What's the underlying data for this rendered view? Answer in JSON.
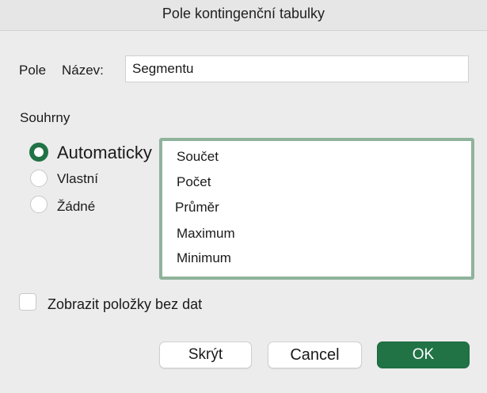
{
  "window": {
    "title": "Pole kontingenční tabulky"
  },
  "field": {
    "section_label": "Pole",
    "name_label": "Název:",
    "name_value": "Segmentu"
  },
  "subtotals": {
    "heading": "Souhrny",
    "options": [
      {
        "label": "Automaticky",
        "selected": true
      },
      {
        "label": "Vlastní",
        "selected": false
      },
      {
        "label": "Žádné",
        "selected": false
      }
    ],
    "functions": [
      "Součet",
      "Počet",
      "Průměr",
      "Maximum",
      "Minimum"
    ]
  },
  "show_items_without_data": {
    "label": "Zobrazit položky bez dat",
    "checked": false
  },
  "buttons": {
    "hide": "Skrýt",
    "cancel": "Cancel",
    "ok": "OK"
  },
  "colors": {
    "accent": "#217346",
    "list_border": "#8fb39b"
  }
}
